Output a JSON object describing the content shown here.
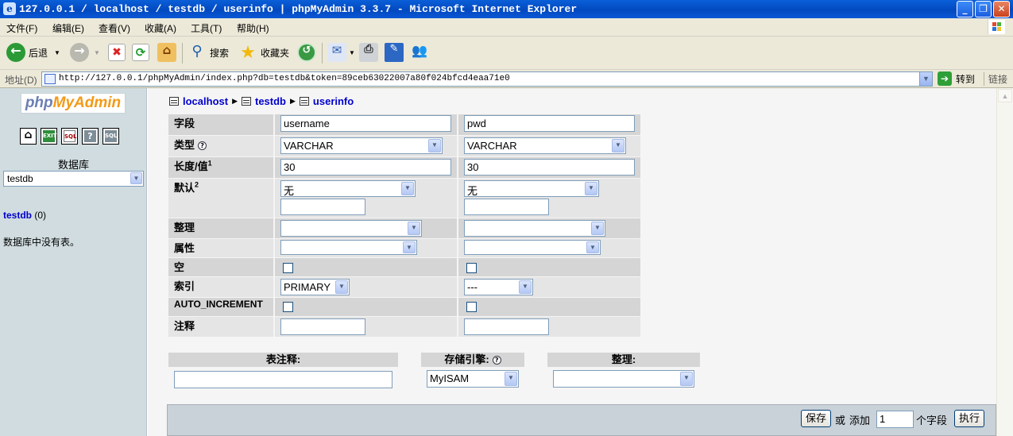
{
  "window": {
    "title": "127.0.0.1 / localhost / testdb / userinfo | phpMyAdmin 3.3.7 - Microsoft Internet Explorer"
  },
  "menu": [
    "文件(F)",
    "编辑(E)",
    "查看(V)",
    "收藏(A)",
    "工具(T)",
    "帮助(H)"
  ],
  "toolbar": {
    "back": "后退",
    "search": "搜索",
    "favorites": "收藏夹"
  },
  "address": {
    "label": "地址(D)",
    "url": "http://127.0.0.1/phpMyAdmin/index.php?db=testdb&token=89ceb63022007a80f024bfcd4eaa71e0",
    "go": "转到",
    "links": "链接"
  },
  "sidebar": {
    "logo_a": "php",
    "logo_b": "MyAdmin",
    "quick_icons": [
      "home-icon",
      "exit-icon",
      "sql-query-icon",
      "help-docs-icon",
      "sql-docs-icon"
    ],
    "db_label": "数据库",
    "db_selected": "testdb",
    "db_link": "testdb",
    "db_count": "(0)",
    "no_tables": "数据库中没有表。"
  },
  "breadcrumb": {
    "server": "localhost",
    "db": "testdb",
    "table": "userinfo"
  },
  "fields": {
    "labels": {
      "name": "字段",
      "type": "类型",
      "length": "长度/值",
      "length_sup": "1",
      "default": "默认",
      "default_sup": "2",
      "collation": "整理",
      "attributes": "属性",
      "null": "空",
      "index": "索引",
      "auto_increment": "AUTO_INCREMENT",
      "comment": "注释"
    },
    "columns": [
      {
        "name": "username",
        "type": "VARCHAR",
        "length": "30",
        "default": "无",
        "collation": "",
        "attribute": "",
        "null": false,
        "index": "PRIMARY",
        "auto_increment": false,
        "comment": ""
      },
      {
        "name": "pwd",
        "type": "VARCHAR",
        "length": "30",
        "default": "无",
        "collation": "",
        "attribute": "",
        "null": false,
        "index": "---",
        "auto_increment": false,
        "comment": ""
      }
    ]
  },
  "table_options": {
    "comment_label": "表注释:",
    "comment_value": "",
    "engine_label": "存储引擎:",
    "engine_value": "MyISAM",
    "collation_label": "整理:",
    "collation_value": ""
  },
  "footer": {
    "save": "保存",
    "or": "或",
    "add": "添加",
    "add_count": "1",
    "fields_unit": "个字段",
    "execute": "执行"
  }
}
